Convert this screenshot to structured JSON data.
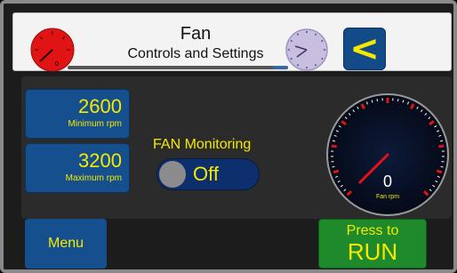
{
  "header": {
    "title": "Fan",
    "subtitle": "Controls and Settings",
    "back_label": "<",
    "mini_gauge_value": "0",
    "progress_segments": [
      0.0,
      0.85,
      0.93,
      1.0
    ]
  },
  "controls": {
    "min_rpm": {
      "value": "2600",
      "label": "Minimum rpm"
    },
    "max_rpm": {
      "value": "3200",
      "label": "Maximum rpm"
    },
    "monitoring": {
      "label": "FAN Monitoring",
      "state": "Off"
    }
  },
  "gauge": {
    "value": "0",
    "unit_label": "Fan rpm",
    "needle_fraction": 0.0
  },
  "footer": {
    "menu_label": "Menu",
    "run_label_top": "Press to",
    "run_label_main": "RUN"
  },
  "colors": {
    "accent_yellow": "#f5e900",
    "button_blue": "#154f8e",
    "run_green": "#1f8a2c",
    "gauge_red": "#e01414"
  }
}
